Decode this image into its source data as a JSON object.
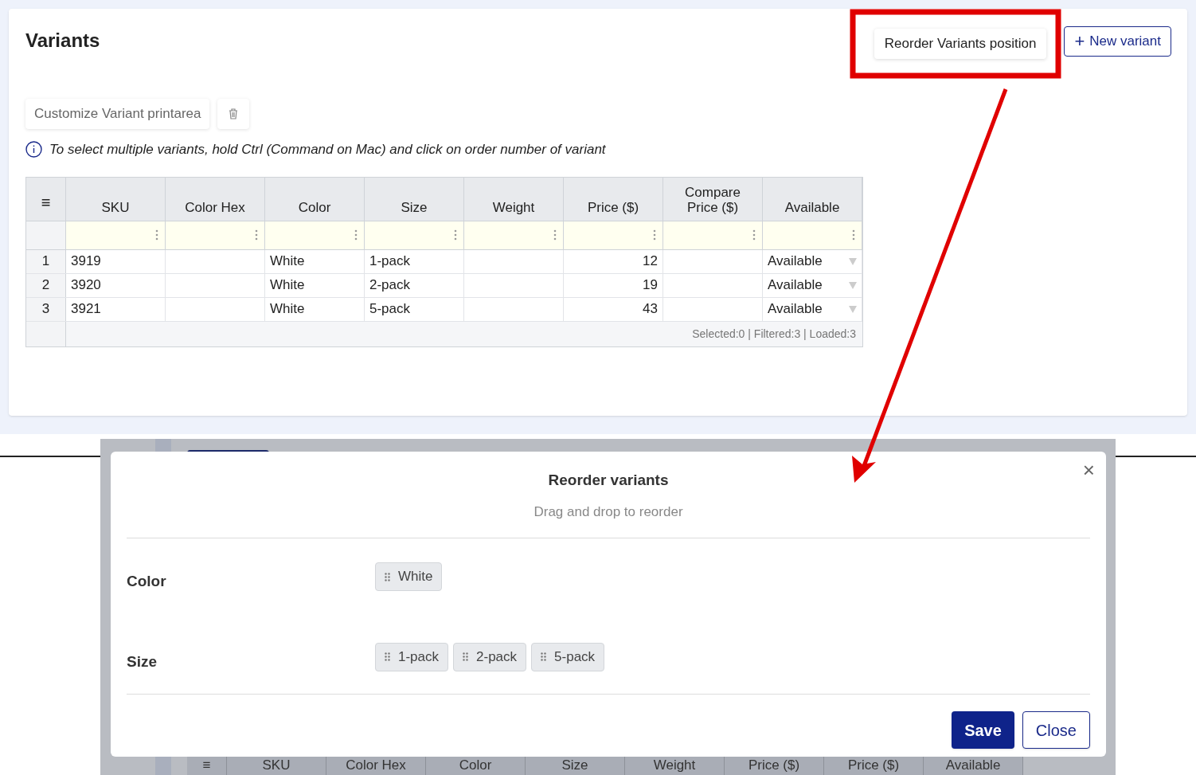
{
  "card": {
    "title": "Variants",
    "reorder_button": "Reorder Variants position",
    "new_variant_button": {
      "icon": "+",
      "label": "New variant"
    },
    "customize_button": "Customize Variant printarea",
    "info_text": "To select multiple variants, hold Ctrl (Command on Mac) and click on order number of variant"
  },
  "table": {
    "menu_icon": "≡",
    "columns": [
      {
        "label": "SKU",
        "kind": "text"
      },
      {
        "label": "Color Hex",
        "kind": "text"
      },
      {
        "label": "Color",
        "kind": "text"
      },
      {
        "label": "Size",
        "kind": "text"
      },
      {
        "label": "Weight",
        "kind": "text"
      },
      {
        "label": "Price ($)",
        "kind": "number"
      },
      {
        "label": "Compare Price ($)",
        "kind": "number"
      },
      {
        "label": "Available",
        "kind": "select"
      }
    ],
    "rows": [
      {
        "index": "1",
        "cells": [
          "3919",
          "",
          "White",
          "1-pack",
          "",
          "12",
          "",
          "Available"
        ]
      },
      {
        "index": "2",
        "cells": [
          "3920",
          "",
          "White",
          "2-pack",
          "",
          "19",
          "",
          "Available"
        ]
      },
      {
        "index": "3",
        "cells": [
          "3921",
          "",
          "White",
          "5-pack",
          "",
          "43",
          "",
          "Available"
        ]
      }
    ],
    "status": "Selected:0 | Filtered:3 | Loaded:3"
  },
  "modal": {
    "title": "Reorder variants",
    "subtitle": "Drag and drop to reorder",
    "close_icon": "×",
    "groups": [
      {
        "label": "Color",
        "options": [
          "White"
        ]
      },
      {
        "label": "Size",
        "options": [
          "1-pack",
          "2-pack",
          "5-pack"
        ]
      }
    ],
    "buttons": [
      {
        "label": "Save",
        "kind": "primary"
      },
      {
        "label": "Close",
        "kind": "outline"
      }
    ]
  },
  "background_table_header": [
    "≡",
    "SKU",
    "Color Hex",
    "Color",
    "Size",
    "Weight",
    "Price ($)",
    "Price ($)",
    "Available"
  ]
}
